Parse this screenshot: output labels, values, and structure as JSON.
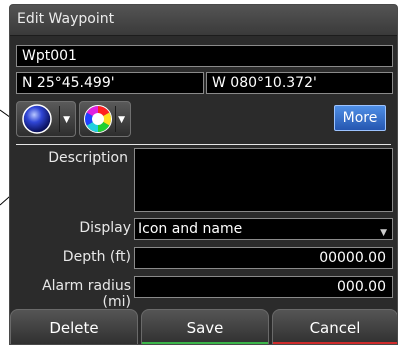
{
  "dialog": {
    "title": "Edit Waypoint"
  },
  "waypoint": {
    "name": "Wpt001",
    "latitude": "N 25°45.499'",
    "longitude": "W 080°10.372'"
  },
  "toolbar": {
    "more_label": "More"
  },
  "form": {
    "description_label": "Description",
    "description_value": "",
    "display_label": "Display",
    "display_value": "Icon and name",
    "depth_label": "Depth (ft)",
    "depth_value": "00000.00",
    "alarm_label": "Alarm radius (mi)",
    "alarm_value": "000.00"
  },
  "buttons": {
    "delete": "Delete",
    "save": "Save",
    "cancel": "Cancel"
  },
  "colors": {
    "accent": "#3a75d4",
    "save_underline": "#3bb54a",
    "cancel_underline": "#d02c2c"
  },
  "icons": {
    "symbol": "blue-sphere-icon",
    "color": "color-wheel-icon"
  }
}
